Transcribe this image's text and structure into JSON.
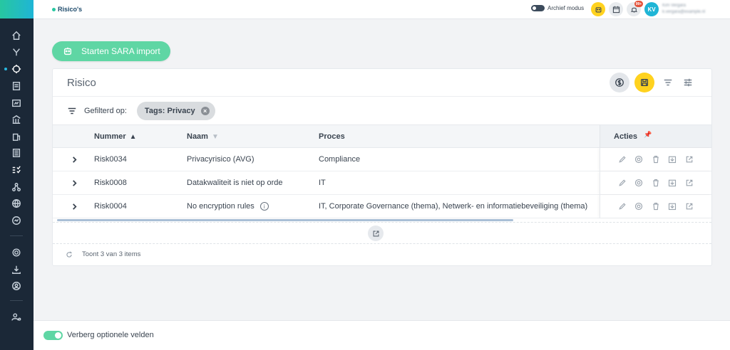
{
  "topbar": {
    "app_title": "Risico's",
    "archive_label": "Archief modus",
    "notif_count": "99+",
    "avatar_initials": "KV",
    "user_name": "Kim Vergara",
    "user_email": "k.vergara@example.nl"
  },
  "import_button": "Starten SARA import",
  "card": {
    "title": "Risico",
    "filter_label": "Gefilterd op:",
    "filter_chip": "Tags: Privacy",
    "chip_remove": "×"
  },
  "table": {
    "headers": {
      "number": "Nummer",
      "name": "Naam",
      "process": "Proces",
      "actions": "Acties"
    },
    "rows": [
      {
        "number": "Risk0034",
        "name": "Privacyrisico (AVG)",
        "process": "Compliance",
        "has_info": false
      },
      {
        "number": "Risk0008",
        "name": "Datakwaliteit is niet op orde",
        "process": "IT",
        "has_info": false
      },
      {
        "number": "Risk0004",
        "name": "No encryption rules",
        "process": "IT, Corporate Governance (thema), Netwerk- en informatiebeveiliging (thema)",
        "has_info": true
      }
    ],
    "info_glyph": "i",
    "footer_text": "Toont 3 van 3 items"
  },
  "bottombar": {
    "toggle_label": "Verberg optionele velden"
  },
  "colors": {
    "sidebar": "#1b2837",
    "accent_green": "#5fd6a4",
    "accent_yellow": "#ffd21f",
    "avatar": "#1fb5d6",
    "badge": "#e4533a"
  }
}
